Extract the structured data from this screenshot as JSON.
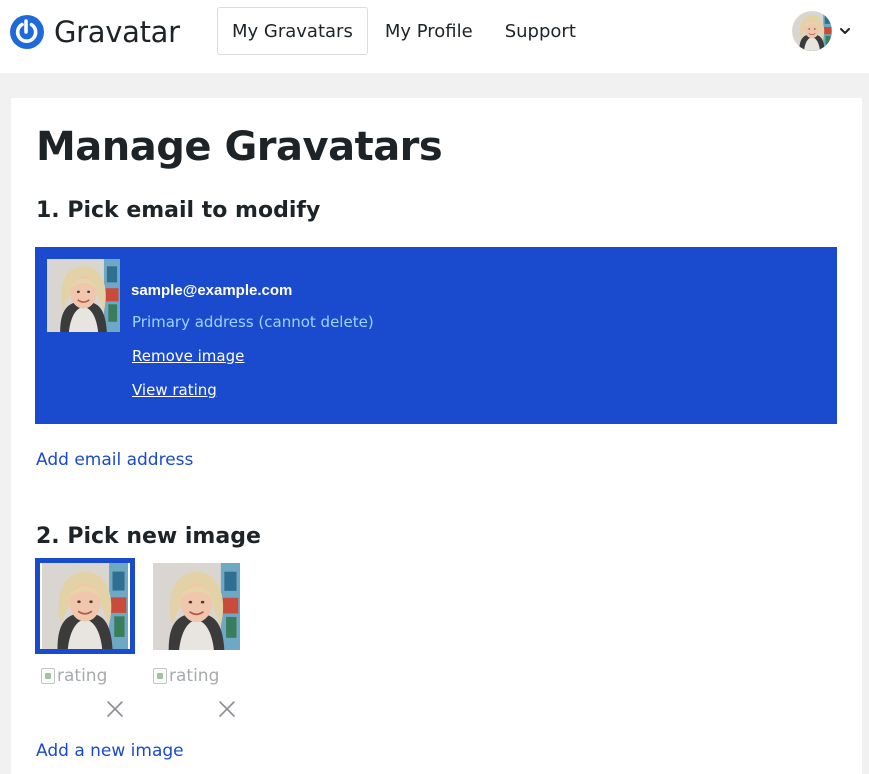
{
  "header": {
    "logo_text": "Gravatar",
    "nav": [
      {
        "label": "My Gravatars",
        "active": true
      },
      {
        "label": "My Profile",
        "active": false
      },
      {
        "label": "Support",
        "active": false
      }
    ],
    "user_menu_icon": "chevron-down-icon"
  },
  "main": {
    "title": "Manage Gravatars",
    "section1": {
      "heading": "1. Pick email to modify",
      "email": {
        "address": "sample@example.com",
        "status": "Primary address (cannot delete)",
        "remove_label": "Remove image",
        "rating_label": "View rating"
      },
      "add_email_label": "Add email address"
    },
    "section2": {
      "heading": "2. Pick new image",
      "images": [
        {
          "rating_alt": "rating",
          "selected": true
        },
        {
          "rating_alt": "rating",
          "selected": false
        }
      ],
      "add_image_label": "Add a new image"
    }
  },
  "colors": {
    "accent": "#1a4ace",
    "status_text": "#9fd3ff"
  }
}
